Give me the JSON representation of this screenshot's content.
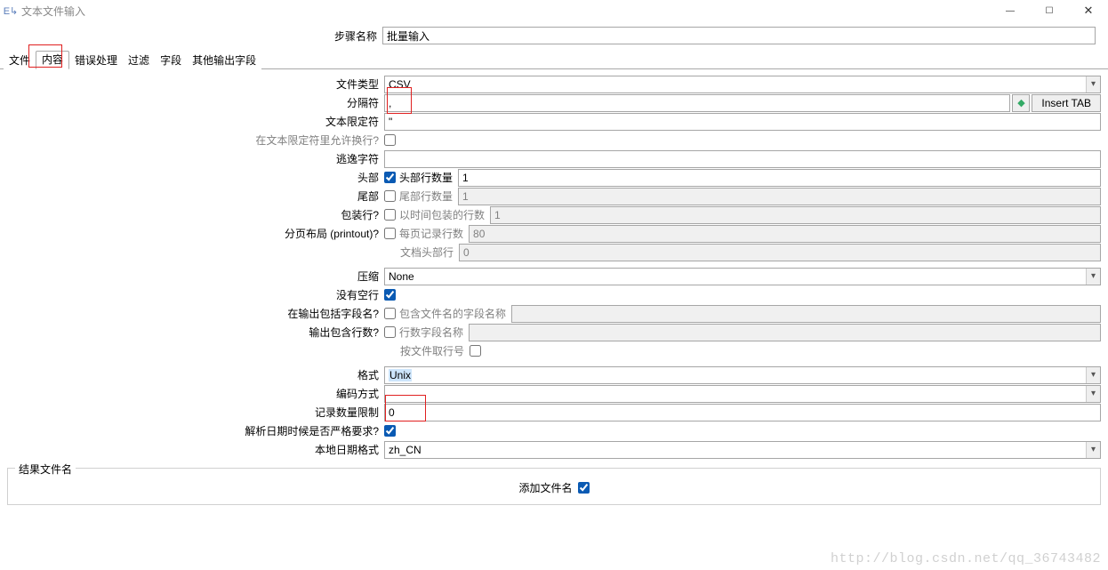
{
  "window": {
    "title": "文本文件输入",
    "min": "—",
    "max": "☐",
    "close": "✕"
  },
  "stepname": {
    "label": "步骤名称",
    "value": "批量输入"
  },
  "tabs": [
    "文件",
    "内容",
    "错误处理",
    "过滤",
    "字段",
    "其他输出字段"
  ],
  "active_tab_index": 1,
  "form": {
    "file_type": {
      "label": "文件类型",
      "value": "CSV"
    },
    "separator": {
      "label": "分隔符",
      "value": ",",
      "insert_tab": "Insert TAB"
    },
    "enclosure": {
      "label": "文本限定符",
      "value": "\""
    },
    "allow_newline_in_enclosure": {
      "label": "在文本限定符里允许换行?",
      "checked": false
    },
    "escape": {
      "label": "逃逸字符",
      "value": ""
    },
    "header": {
      "label": "头部",
      "chk_label": "头部行数量",
      "checked": true,
      "value": "1"
    },
    "footer": {
      "label": "尾部",
      "chk_label": "尾部行数量",
      "checked": false,
      "value": "1"
    },
    "wrapped": {
      "label": "包装行?",
      "chk_label": "以时间包装的行数",
      "checked": false,
      "value": "1"
    },
    "paged": {
      "label": "分页布局 (printout)?",
      "chk_label": "每页记录行数",
      "checked": false,
      "value": "80"
    },
    "doc_header_lines": {
      "label": "文档头部行",
      "value": "0"
    },
    "compression": {
      "label": "压缩",
      "value": "None"
    },
    "no_empty_rows": {
      "label": "没有空行",
      "checked": true
    },
    "include_filename": {
      "label": "在输出包括字段名?",
      "chk_label": "包含文件名的字段名称",
      "checked": false,
      "value": ""
    },
    "include_rownum": {
      "label": "输出包含行数?",
      "chk_label": "行数字段名称",
      "checked": false,
      "value": ""
    },
    "rownum_by_file": {
      "label": "按文件取行号",
      "checked": false
    },
    "format": {
      "label": "格式",
      "value": "Unix"
    },
    "encoding": {
      "label": "编码方式",
      "value": ""
    },
    "row_limit": {
      "label": "记录数量限制",
      "value": "0"
    },
    "strict_date": {
      "label": "解析日期时候是否严格要求?",
      "checked": true
    },
    "date_locale": {
      "label": "本地日期格式",
      "value": "zh_CN"
    }
  },
  "group_result": {
    "legend": "结果文件名",
    "add_filename": {
      "label": "添加文件名",
      "checked": true
    }
  },
  "watermark": "http://blog.csdn.net/qq_36743482"
}
